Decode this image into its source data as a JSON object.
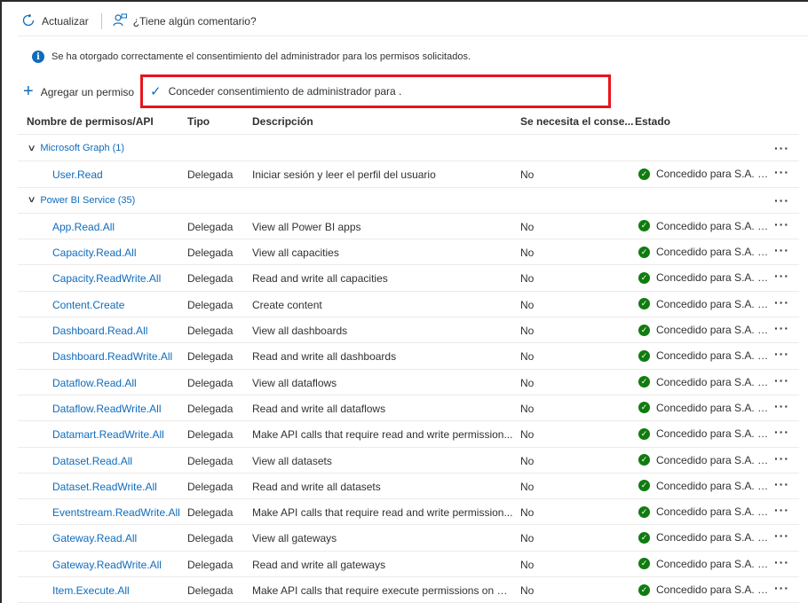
{
  "toolbar": {
    "refresh_label": "Actualizar",
    "feedback_label": "¿Tiene algún comentario?"
  },
  "info_message": "Se ha otorgado correctamente el consentimiento del administrador para los permisos solicitados.",
  "commands": {
    "add_permission": "Agregar un permiso",
    "grant_consent": "Conceder consentimiento de administrador para ."
  },
  "columns": {
    "name": "Nombre de permisos/API",
    "type": "Tipo",
    "description": "Descripción",
    "admin_consent": "Se necesita el conse...",
    "status": "Estado"
  },
  "groups": [
    {
      "label": "Microsoft Graph (1)",
      "rows": [
        {
          "name": "User.Read",
          "type": "Delegada",
          "description": "Iniciar sesión y leer el perfil del usuario",
          "admin": "No",
          "status": "Concedido para S.A. DE ..."
        }
      ]
    },
    {
      "label": "Power BI Service (35)",
      "rows": [
        {
          "name": "App.Read.All",
          "type": "Delegada",
          "description": "View all Power BI apps",
          "admin": "No",
          "status": "Concedido para S.A. DE ..."
        },
        {
          "name": "Capacity.Read.All",
          "type": "Delegada",
          "description": "View all capacities",
          "admin": "No",
          "status": "Concedido para S.A. DE ..."
        },
        {
          "name": "Capacity.ReadWrite.All",
          "type": "Delegada",
          "description": "Read and write all capacities",
          "admin": "No",
          "status": "Concedido para S.A. DE ..."
        },
        {
          "name": "Content.Create",
          "type": "Delegada",
          "description": "Create content",
          "admin": "No",
          "status": "Concedido para S.A. DE ..."
        },
        {
          "name": "Dashboard.Read.All",
          "type": "Delegada",
          "description": "View all dashboards",
          "admin": "No",
          "status": "Concedido para S.A. DE ..."
        },
        {
          "name": "Dashboard.ReadWrite.All",
          "type": "Delegada",
          "description": "Read and write all dashboards",
          "admin": "No",
          "status": "Concedido para S.A. DE ..."
        },
        {
          "name": "Dataflow.Read.All",
          "type": "Delegada",
          "description": "View all dataflows",
          "admin": "No",
          "status": "Concedido para S.A. DE ..."
        },
        {
          "name": "Dataflow.ReadWrite.All",
          "type": "Delegada",
          "description": "Read and write all dataflows",
          "admin": "No",
          "status": "Concedido para S.A. DE ..."
        },
        {
          "name": "Datamart.ReadWrite.All",
          "type": "Delegada",
          "description": "Make API calls that require read and write permission...",
          "admin": "No",
          "status": "Concedido para S.A. DE ..."
        },
        {
          "name": "Dataset.Read.All",
          "type": "Delegada",
          "description": "View all datasets",
          "admin": "No",
          "status": "Concedido para S.A. DE ..."
        },
        {
          "name": "Dataset.ReadWrite.All",
          "type": "Delegada",
          "description": "Read and write all datasets",
          "admin": "No",
          "status": "Concedido para S.A. DE ..."
        },
        {
          "name": "Eventstream.ReadWrite.All",
          "type": "Delegada",
          "description": "Make API calls that require read and write permission...",
          "admin": "No",
          "status": "Concedido para S.A. DE ..."
        },
        {
          "name": "Gateway.Read.All",
          "type": "Delegada",
          "description": "View all gateways",
          "admin": "No",
          "status": "Concedido para S.A. DE ..."
        },
        {
          "name": "Gateway.ReadWrite.All",
          "type": "Delegada",
          "description": "Read and write all gateways",
          "admin": "No",
          "status": "Concedido para S.A. DE ..."
        },
        {
          "name": "Item.Execute.All",
          "type": "Delegada",
          "description": "Make API calls that require execute permissions on all...",
          "admin": "No",
          "status": "Concedido para S.A. DE ..."
        }
      ]
    }
  ],
  "colors": {
    "accent": "#0f6cbd",
    "success": "#107c10",
    "highlight_border": "#e8141b"
  }
}
